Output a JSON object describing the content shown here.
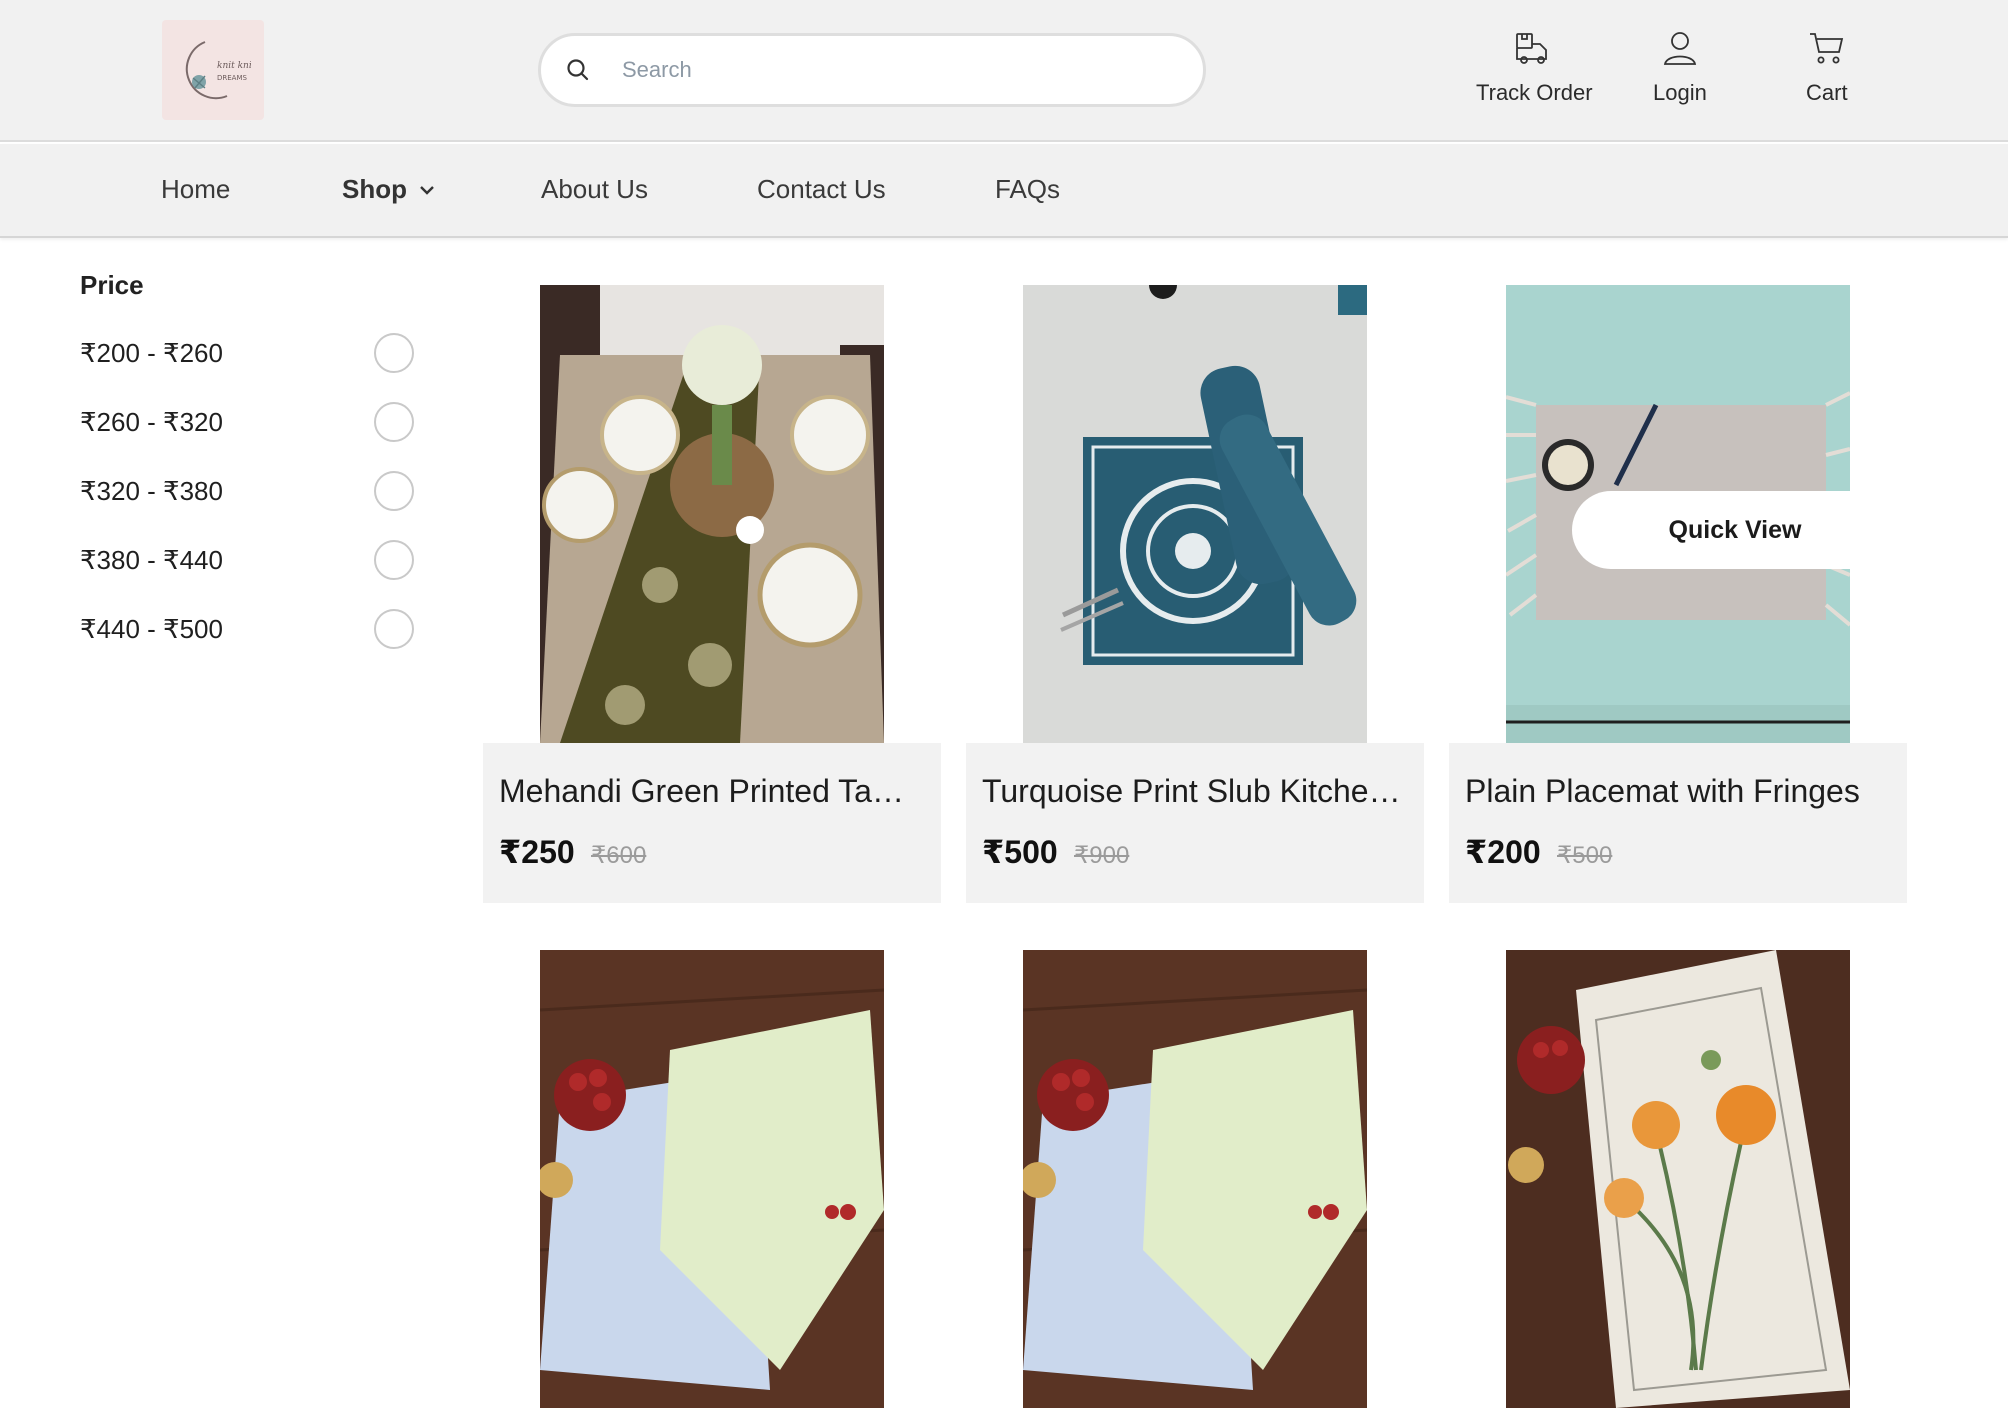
{
  "header": {
    "logo_text": [
      "knit knit",
      "DREAMS"
    ],
    "search_placeholder": "Search",
    "actions": [
      {
        "label": "Track Order",
        "icon": "truck-box-icon"
      },
      {
        "label": "Login",
        "icon": "user-icon"
      },
      {
        "label": "Cart",
        "icon": "cart-icon"
      }
    ]
  },
  "nav": {
    "items": [
      "Home",
      "Shop",
      "About Us",
      "Contact Us",
      "FAQs"
    ],
    "active": "Shop"
  },
  "filter": {
    "title": "Price",
    "ranges": [
      "₹200 - ₹260",
      "₹260 - ₹320",
      "₹320 - ₹380",
      "₹380 - ₹440",
      "₹440 - ₹500"
    ]
  },
  "products": [
    {
      "name": "Mehandi Green Printed Table Runner",
      "price": "₹250",
      "mrp": "₹600"
    },
    {
      "name": "Turquoise Print Slub Kitchen Placemat",
      "price": "₹500",
      "mrp": "₹900"
    },
    {
      "name": "Plain Placemat with Fringes",
      "price": "₹200",
      "mrp": "₹500",
      "quick_view": "Quick View"
    },
    {
      "name": "",
      "price": "",
      "mrp": ""
    },
    {
      "name": "",
      "price": "",
      "mrp": ""
    },
    {
      "name": "",
      "price": "",
      "mrp": ""
    }
  ],
  "colors": {
    "header_bg": "#f1f1f1",
    "card_bg": "#f2f2f2",
    "mrp": "#9b9b9b"
  }
}
